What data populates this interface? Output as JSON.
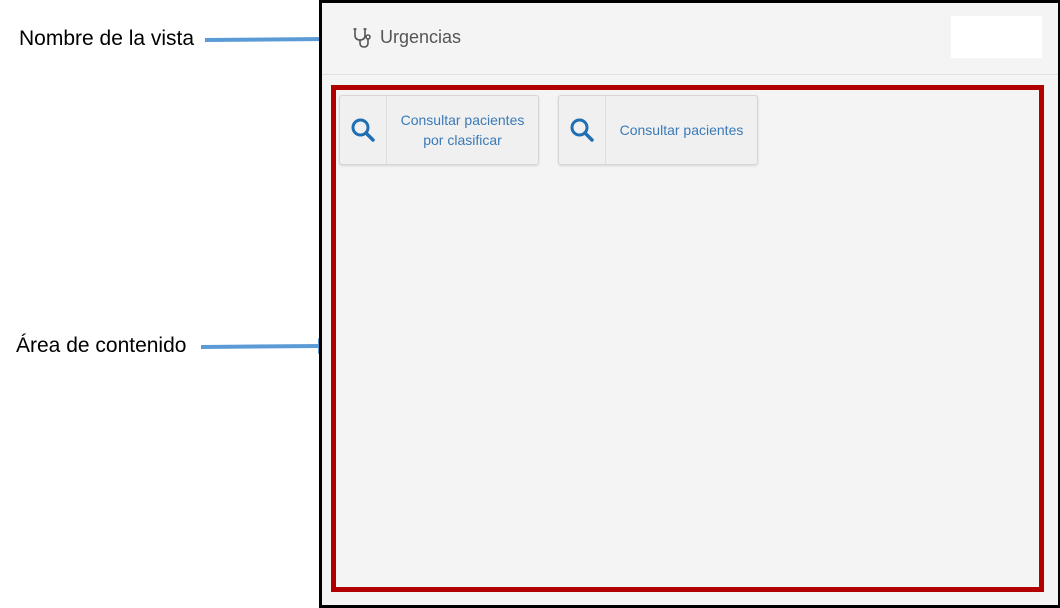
{
  "annotations": {
    "view_name_label": "Nombre de la vista",
    "content_area_label": "Área de contenido"
  },
  "header": {
    "icon": "stethoscope-icon",
    "title": "Urgencias"
  },
  "content": {
    "buttons": [
      {
        "icon": "search-icon",
        "label_line1": "Consultar pacientes",
        "label_line2": "por clasificar"
      },
      {
        "icon": "search-icon",
        "label": "Consultar pacientes"
      }
    ]
  },
  "colors": {
    "highlight_border": "#b00000",
    "arrow": "#5b9bd5",
    "button_text": "#3a7ab8",
    "search_icon": "#1f6fb2"
  }
}
